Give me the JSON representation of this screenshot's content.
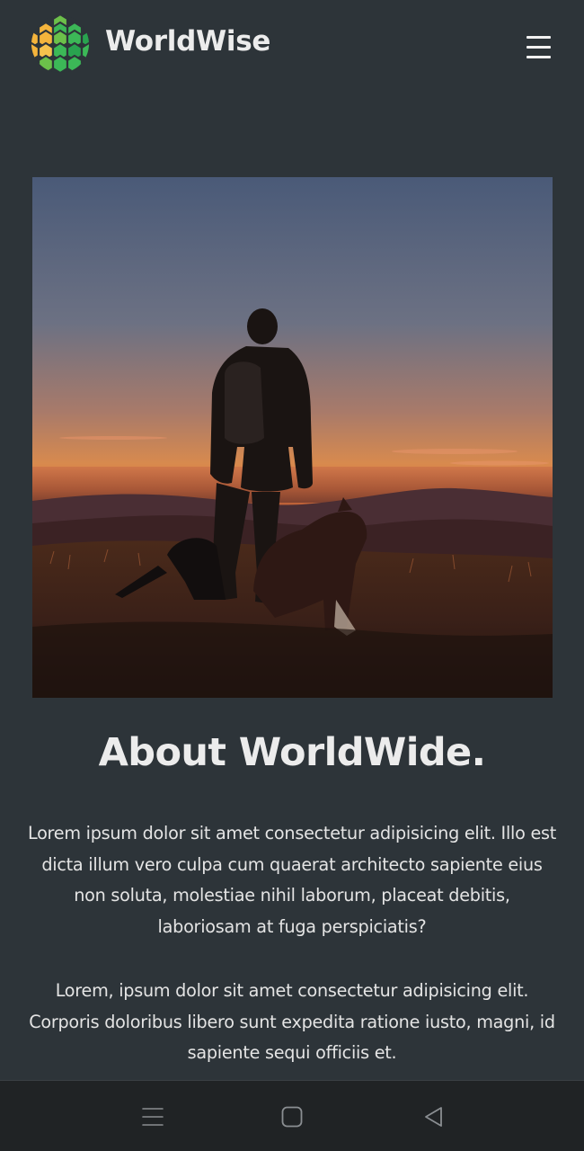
{
  "header": {
    "brand": "WorldWise",
    "logo_icon": "worldwise-globe-logo",
    "menu_icon": "hamburger-menu-icon"
  },
  "hero": {
    "image": "person-and-dogs-sunset-silhouette"
  },
  "about": {
    "title": "About WorldWide.",
    "paragraphs": [
      "Lorem ipsum dolor sit amet consectetur adipisicing elit. Illo est dicta illum vero culpa cum quaerat architecto sapiente eius non soluta, molestiae nihil laborum, placeat debitis, laboriosam at fuga perspiciatis?",
      "Lorem, ipsum dolor sit amet consectetur adipisicing elit. Corporis doloribus libero sunt expedita ratione iusto, magni, id sapiente sequi officiis et."
    ]
  },
  "system_nav": {
    "buttons": [
      "recent-apps-icon",
      "home-icon",
      "back-icon"
    ]
  },
  "colors": {
    "background": "#2d3439",
    "text": "#ececec",
    "navbar": "#202325",
    "logo_green": "#3cb857",
    "logo_yellow": "#f4b43c"
  }
}
